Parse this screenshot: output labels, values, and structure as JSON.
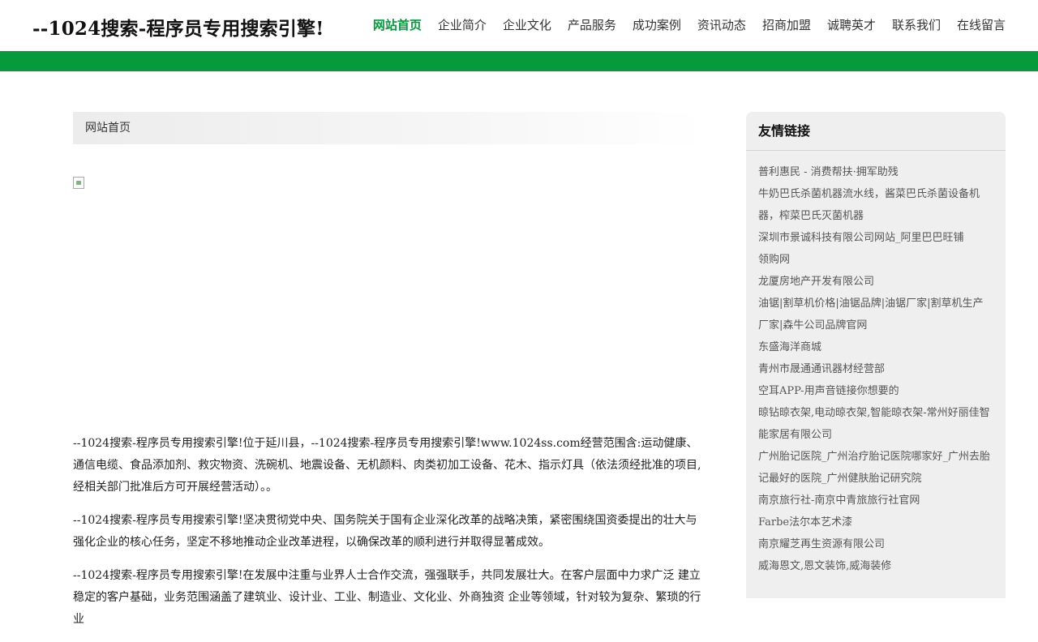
{
  "header": {
    "site_title": "--1024搜索-程序员专用搜索引擎!",
    "nav": [
      "网站首页",
      "企业简介",
      "企业文化",
      "产品服务",
      "成功案例",
      "资讯动态",
      "招商加盟",
      "诚聘英才",
      "联系我们",
      "在线留言"
    ]
  },
  "colors": {
    "brand_green": "#069a3d",
    "sidebar_bg": "#efefef"
  },
  "breadcrumb": {
    "home": "网站首页"
  },
  "image": {
    "icon": "broken-image-icon"
  },
  "article": {
    "paragraphs": [
      "--1024搜索-程序员专用搜索引擎!位于延川县，--1024搜索-程序员专用搜索引擎!www.1024ss.com经营范围含:运动健康、通信电缆、食品添加剂、救灾物资、洗碗机、地震设备、无机颜料、肉类初加工设备、花木、指示灯具（依法须经批准的项目,经相关部门批准后方可开展经营活动）。。",
      "--1024搜索-程序员专用搜索引擎!坚决贯彻党中央、国务院关于国有企业深化改革的战略决策，紧密围绕国资委提出的壮大与强化企业的核心任务，坚定不移地推动企业改革进程，以确保改革的顺利进行并取得显著成效。",
      "--1024搜索-程序员专用搜索引擎!在发展中注重与业界人士合作交流，强强联手，共同发展壮大。在客户层面中力求广泛 建立稳定的客户基础，业务范围涵盖了建筑业、设计业、工业、制造业、文化业、外商独资 企业等领域，针对较为复杂、繁琐的行业"
    ]
  },
  "sidebar": {
    "title": "友情链接",
    "links": [
      "普利惠民 - 消费帮扶·拥军助残",
      "牛奶巴氏杀菌机器流水线，酱菜巴氏杀菌设备机器，榨菜巴氏灭菌机器",
      "深圳市景诚科技有限公司网站_阿里巴巴旺铺",
      "领购网",
      "龙厦房地产开发有限公司",
      "油锯|割草机价格|油锯品牌|油锯厂家|割草机生产厂家|森牛公司品牌官网",
      "东盛海洋商城",
      "青州市晟通通讯器材经营部",
      "空耳APP-用声音链接你想要的",
      "晾钻晾衣架,电动晾衣架,智能晾衣架-常州好丽佳智能家居有限公司",
      "广州胎记医院_广州治疗胎记医院哪家好_广州去胎记最好的医院_广州健肤胎记研究院",
      "南京旅行社-南京中青旅旅行社官网",
      "Farbe法尔本艺术漆",
      "南京耀芝再生资源有限公司",
      "威海恩文,恩文装饰,威海装修"
    ]
  }
}
